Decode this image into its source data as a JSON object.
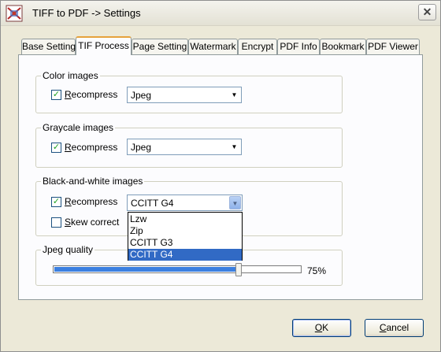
{
  "window": {
    "title": "TIFF to PDF -> Settings",
    "app_icon": "tiff-to-pdf-app-icon",
    "close_label": "✕"
  },
  "tabs": [
    {
      "label": "Base Setting",
      "active": false
    },
    {
      "label": "TIF Process",
      "active": true
    },
    {
      "label": "Page Setting",
      "active": false
    },
    {
      "label": "Watermark",
      "active": false
    },
    {
      "label": "Encrypt",
      "active": false
    },
    {
      "label": "PDF Info",
      "active": false
    },
    {
      "label": "Bookmark",
      "active": false
    },
    {
      "label": "PDF Viewer",
      "active": false
    }
  ],
  "color_group": {
    "title": "Color images",
    "recompress_checked": true,
    "recompress_label_first": "R",
    "recompress_label_rest": "ecompress",
    "format_value": "Jpeg"
  },
  "gray_group": {
    "title": "Graycale images",
    "recompress_checked": true,
    "recompress_label_first": "R",
    "recompress_label_rest": "ecompress",
    "format_value": "Jpeg"
  },
  "bw_group": {
    "title": "Black-and-white images",
    "recompress_checked": true,
    "recompress_label_first": "R",
    "recompress_label_rest": "ecompress",
    "format_value": "CCITT G4",
    "skew_checked": false,
    "skew_label_first": "S",
    "skew_label_rest": "kew correct",
    "dropdown_open": true,
    "options": [
      "Lzw",
      "Zip",
      "CCITT G3",
      "CCITT G4"
    ],
    "highlighted_option": "CCITT G4"
  },
  "jpeg_group": {
    "title": "Jpeg quality",
    "quality_percent": 75,
    "quality_label": "75%"
  },
  "buttons": {
    "ok_first": "O",
    "ok_rest": "K",
    "cancel_first": "C",
    "cancel_rest": "ancel"
  },
  "colors": {
    "check_mark": "#21a121",
    "slider_fill": "#3b7fe0",
    "selection": "#316ac5",
    "active_tab_accent": "#e6a23c"
  },
  "icons": {
    "checkmark": "✓",
    "combo_arrow": "▼"
  }
}
